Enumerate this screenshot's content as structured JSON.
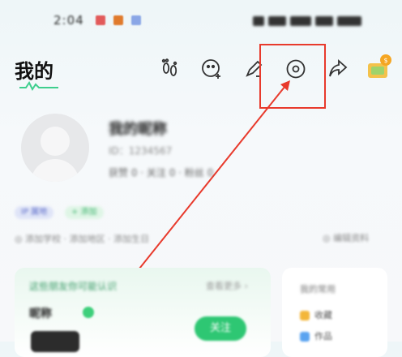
{
  "status_bar": {
    "time": "2:04",
    "dot_colors": [
      "#e25a5a",
      "#e07a2c",
      "#8aa6e6"
    ]
  },
  "header": {
    "title": "我的",
    "icons": [
      "footprint-icon",
      "add-friend-icon",
      "edit-icon",
      "settings-icon",
      "share-icon",
      "reward-icon"
    ]
  },
  "annotation": {
    "box_color": "#e83a2c",
    "target": "settings-icon"
  },
  "profile": {
    "name": "我的昵称",
    "id_line": "ID：1234567",
    "stats": "获赞 0 · 关注 0 · 粉丝 0"
  },
  "tags": [
    "IP 属地",
    "+ 添加"
  ],
  "info_row": {
    "left": "◎ 添加学校 · 添加地区 · 添加生日",
    "right": "◎ 编辑资料"
  },
  "card_main": {
    "title": "这些朋友你可能认识",
    "more": "查看更多 ›",
    "name": "昵称",
    "button": "关注"
  },
  "card_side": {
    "title": "我的常用",
    "rows": [
      "收藏",
      "作品"
    ]
  }
}
